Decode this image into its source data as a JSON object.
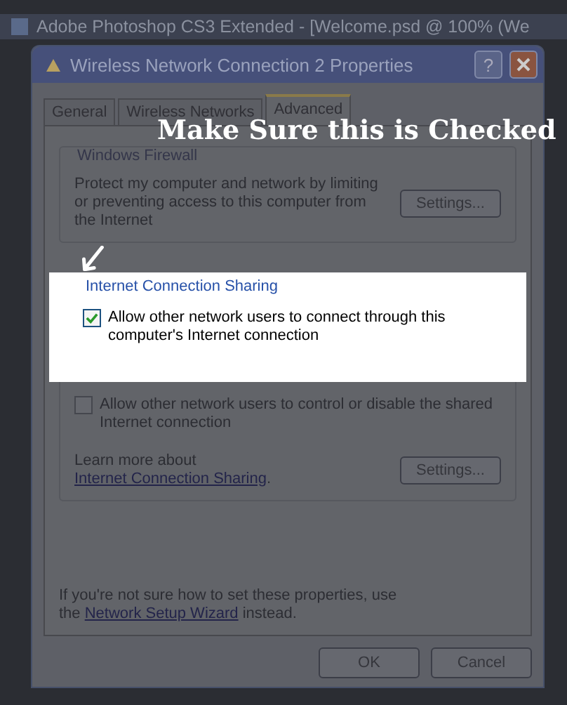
{
  "app_title": "Adobe Photoshop CS3 Extended - [Welcome.psd @ 100% (We",
  "dialog": {
    "title": "Wireless Network Connection 2 Properties",
    "help": "?",
    "tabs": [
      {
        "label": "General",
        "selected": false
      },
      {
        "label": "Wireless Networks",
        "selected": false
      },
      {
        "label": "Advanced",
        "selected": true
      }
    ],
    "firewall": {
      "legend": "Windows Firewall",
      "text": "Protect my computer and network by limiting or preventing access to this computer from the Internet",
      "button": "Settings..."
    },
    "sharing": {
      "legend": "Internet Connection Sharing",
      "options": [
        {
          "label": "Allow other network users to connect through this computer's Internet connection",
          "checked": true
        },
        {
          "label": "Allow other network users to control or disable the shared Internet connection",
          "checked": false
        }
      ],
      "learn_text": "Learn more about",
      "learn_link": "Internet Connection Sharing",
      "learn_end": ".",
      "button": "Settings..."
    },
    "footer": {
      "text": "If you're not sure how to set these properties, use the",
      "link": "Network Setup Wizard",
      "text_end": "instead."
    },
    "buttons": [
      "OK",
      "Cancel"
    ]
  },
  "annotation": "Make Sure this is Checked"
}
